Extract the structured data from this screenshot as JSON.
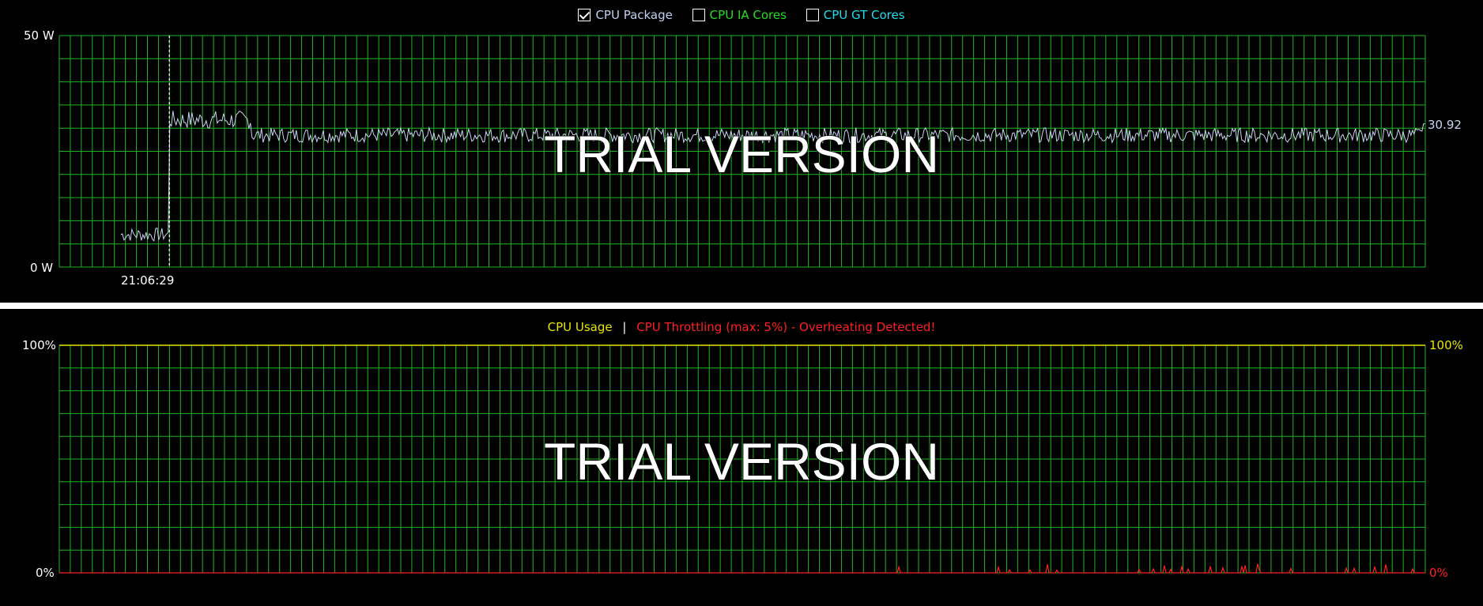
{
  "power_chart": {
    "legend": [
      {
        "label": "CPU Package",
        "checked": true,
        "color": "#c0d0f0"
      },
      {
        "label": "CPU IA Cores",
        "checked": false,
        "color": "#22dd22"
      },
      {
        "label": "CPU GT Cores",
        "checked": false,
        "color": "#22ddee"
      }
    ],
    "y_max_label": "50 W",
    "y_min_label": "0 W",
    "time_label": "21:06:29",
    "current_value": "30.92",
    "watermark": "TRIAL VERSION"
  },
  "usage_chart": {
    "legend_usage": "CPU Usage",
    "legend_separator": "|",
    "legend_throttle": "CPU Throttling (max: 5%) - Overheating Detected!",
    "y_left_max": "100%",
    "y_left_min": "0%",
    "y_right_max": "100%",
    "y_right_min": "0%",
    "watermark": "TRIAL VERSION"
  },
  "colors": {
    "grid": "#1fb51f",
    "package_line": "#c8d4f0",
    "usage": "#e6e600",
    "throttle": "#ff2020",
    "marker": "#ffffff"
  },
  "chart_data": [
    {
      "type": "line",
      "title": "",
      "series": [
        {
          "name": "CPU Package",
          "values_description_only": []
        }
      ],
      "ylim": [
        0,
        50
      ],
      "yunit": "W",
      "segments": [
        {
          "from_fraction": 0.045,
          "to_fraction": 0.08,
          "approx_value": 7
        },
        {
          "from_fraction": 0.08,
          "to_fraction": 0.14,
          "approx_value": 31
        },
        {
          "from_fraction": 0.14,
          "to_fraction": 1.0,
          "approx_value": 28.5
        }
      ],
      "last_value": 30.92,
      "marker_time": "21:06:29",
      "grid": true
    },
    {
      "type": "line",
      "title": "",
      "series": [
        {
          "name": "CPU Usage"
        },
        {
          "name": "CPU Throttling (max: 5%) - Overheating Detected!",
          "max": 5
        }
      ],
      "ylim": [
        0,
        100
      ],
      "yunit": "%",
      "grid": true
    }
  ]
}
